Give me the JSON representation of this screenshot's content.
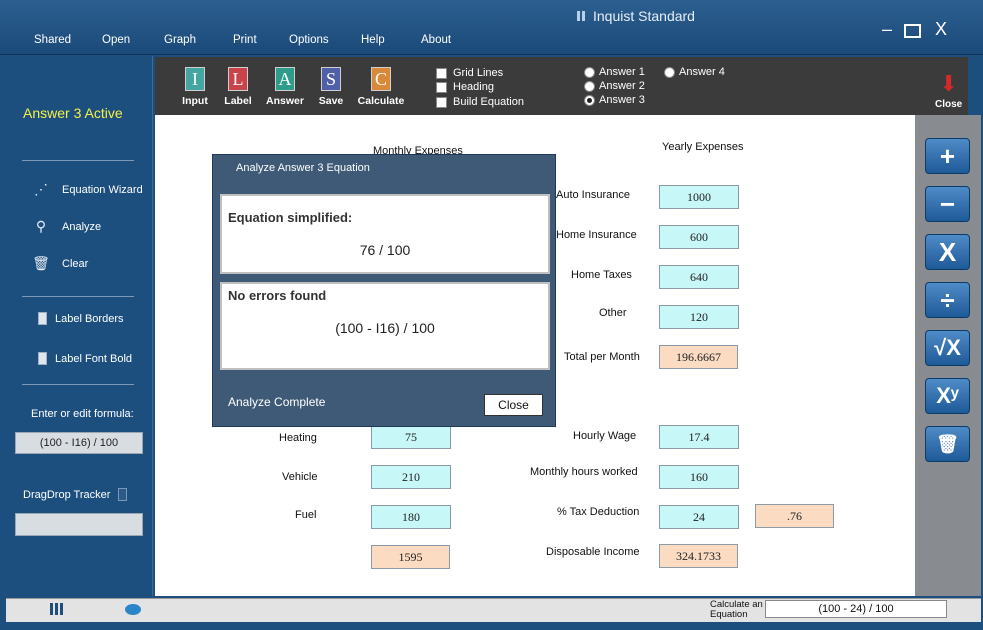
{
  "app": {
    "title": "Inquist Standard"
  },
  "menu": [
    "Shared",
    "Open",
    "Graph",
    "Print",
    "Options",
    "Help",
    "About"
  ],
  "window": {
    "minimize": "–",
    "close": "X"
  },
  "sidebar": {
    "active": "Answer 3 Active",
    "tools": [
      "Equation Wizard",
      "Analyze",
      "Clear"
    ],
    "toggles": [
      "Label Borders",
      "Label Font Bold"
    ],
    "formula_label": "Enter or edit formula:",
    "formula_value": "(100 - I16) / 100",
    "drag_label": "DragDrop Tracker"
  },
  "toolbar": {
    "tools": [
      {
        "letter": "I",
        "label": "Input",
        "color": "#43a6a0"
      },
      {
        "letter": "L",
        "label": "Label",
        "color": "#c8444a"
      },
      {
        "letter": "A",
        "label": "Answer",
        "color": "#2e9c8a"
      },
      {
        "letter": "S",
        "label": "Save",
        "color": "#4f5fa8"
      },
      {
        "letter": "C",
        "label": "Calculate",
        "color": "#d88a3a"
      }
    ],
    "checks": [
      "Grid Lines",
      "Heading",
      "Build Equation"
    ],
    "answers": [
      "Answer 1",
      "Answer 2",
      "Answer 3",
      "Answer 4"
    ],
    "selected_answer": "Answer 3",
    "close": "Close"
  },
  "canvas": {
    "monthly_heading": "Monthly Expenses",
    "yearly_heading": "Yearly Expenses",
    "left_rows": [
      {
        "label": "Heating",
        "value": "75"
      },
      {
        "label": "Vehicle",
        "value": "210"
      },
      {
        "label": "Fuel",
        "value": "180"
      }
    ],
    "left_total": "1595",
    "right_rows": [
      {
        "label": "Auto Insurance",
        "value": "1000"
      },
      {
        "label": "Home Insurance",
        "value": "600"
      },
      {
        "label": "Home Taxes",
        "value": "640"
      },
      {
        "label": "Other",
        "value": "120"
      }
    ],
    "total_per_month_label": "Total per Month",
    "total_per_month": "196.6667",
    "hourly_wage_label": "Hourly Wage",
    "hourly_wage": "17.4",
    "hours_label": "Monthly hours worked",
    "hours": "160",
    "tax_label": "% Tax Deduction",
    "tax": "24",
    "tax_factor": ".76",
    "disposable_label": "Disposable Income",
    "disposable": "324.1733"
  },
  "ops": [
    "+",
    "−",
    "X",
    "÷",
    "√X",
    "Xʸ",
    "trash"
  ],
  "modal": {
    "title": "Analyze Answer 3 Equation",
    "simplified_label": "Equation simplified:",
    "simplified_value": "76 / 100",
    "errors_label": "No errors found",
    "errors_value": "(100 - I16) / 100",
    "status": "Analyze Complete",
    "close": "Close"
  },
  "status": {
    "calc_label_1": "Calculate an",
    "calc_label_2": "Equation",
    "calc_value": "(100 - 24) / 100"
  }
}
